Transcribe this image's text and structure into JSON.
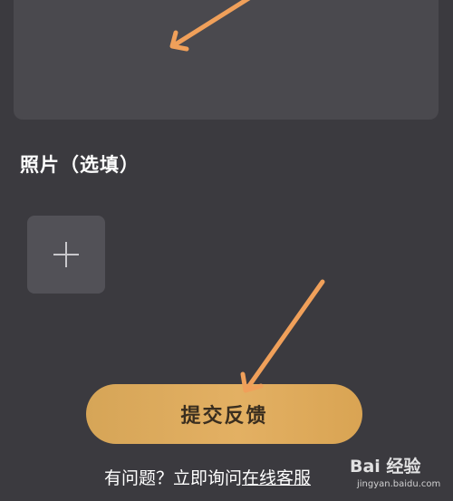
{
  "photos": {
    "section_label": "照片（选填）",
    "add_button_icon": "plus-icon"
  },
  "submit": {
    "label": "提交反馈"
  },
  "footer": {
    "prefix": "有问题？立即询问",
    "link": "在线客服"
  },
  "annotations": {
    "arrow_color": "#f0a05a"
  },
  "watermark": {
    "logo": "Bai 经验",
    "url": "jingyan.baidu.com"
  },
  "colors": {
    "background": "#3b3a3f",
    "card": "#4a494e",
    "button_gold": "#e0ad5f"
  }
}
